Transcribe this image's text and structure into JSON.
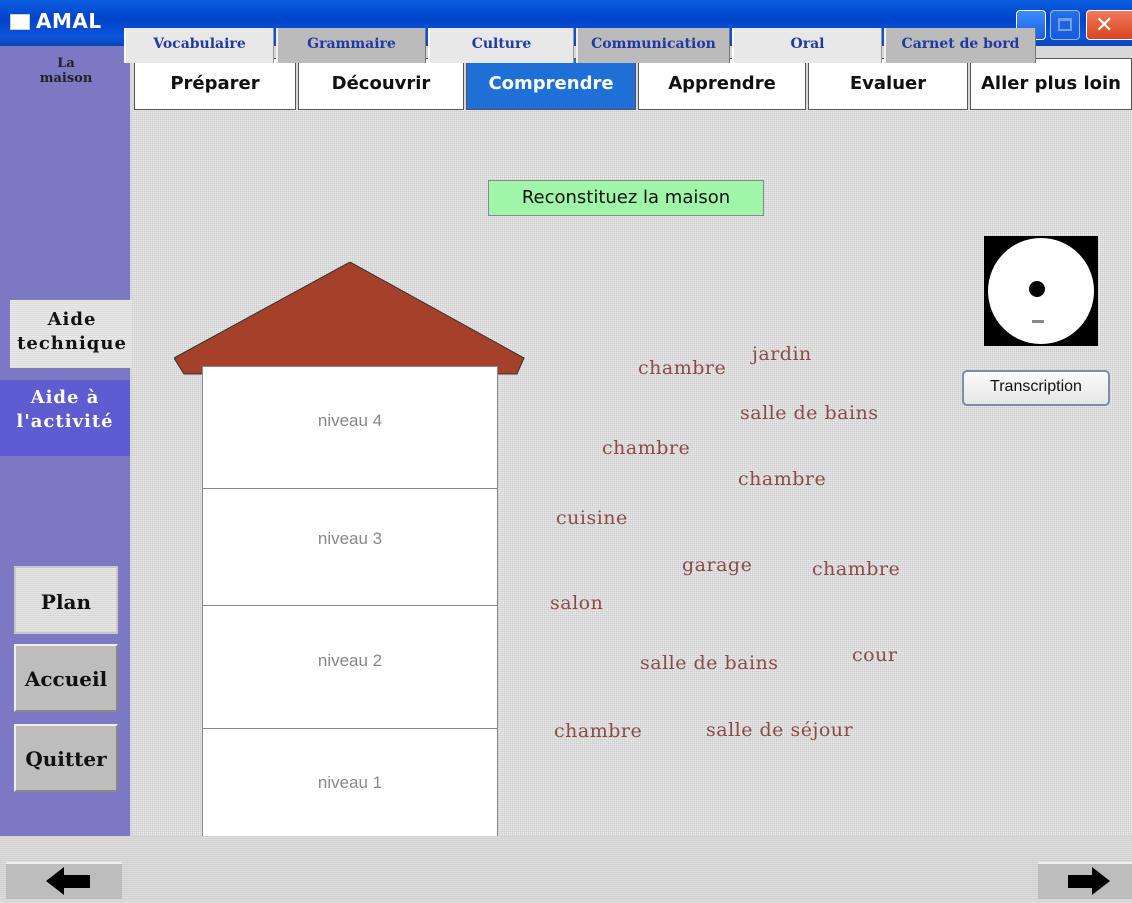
{
  "window": {
    "title": "AMAL",
    "controls": [
      "minimize-icon",
      "maximize-icon",
      "close-icon"
    ]
  },
  "sidebar": {
    "section": "La maison",
    "aide_technique": "Aide technique",
    "aide_activite": "Aide à l'activité",
    "plan": "Plan",
    "accueil": "Accueil",
    "quitter": "Quitter"
  },
  "tabs": [
    {
      "label": "Préparer",
      "active": false
    },
    {
      "label": "Découvrir",
      "active": false
    },
    {
      "label": "Comprendre",
      "active": true
    },
    {
      "label": "Apprendre",
      "active": false
    },
    {
      "label": "Evaluer",
      "active": false
    },
    {
      "label": "Aller plus loin",
      "active": false
    }
  ],
  "activity": {
    "instruction": "Reconstituez la maison",
    "levels": [
      "niveau 4",
      "niveau 3",
      "niveau 2",
      "niveau 1"
    ],
    "words": [
      "chambre",
      "jardin",
      "salle de bains",
      "chambre",
      "chambre",
      "cuisine",
      "garage",
      "chambre",
      "salon",
      "salle de bains",
      "cour",
      "chambre",
      "salle de séjour"
    ],
    "transcription_label": "Transcription"
  },
  "bottom_nav": {
    "prev_icon": "arrow-left-icon",
    "next_icon": "arrow-right-icon",
    "items": [
      "Vocabulaire",
      "Grammaire",
      "Culture",
      "Communication",
      "Oral",
      "Carnet de bord"
    ]
  },
  "colors": {
    "titlebar": "#0a5fe0",
    "sidebar": "#7b79c3",
    "active_tab": "#1e6fd6",
    "instruction_bg": "#9ff5a8",
    "roof": "#a5412a",
    "word_text": "#8c4a47",
    "nav_text": "#1f3aa0"
  }
}
